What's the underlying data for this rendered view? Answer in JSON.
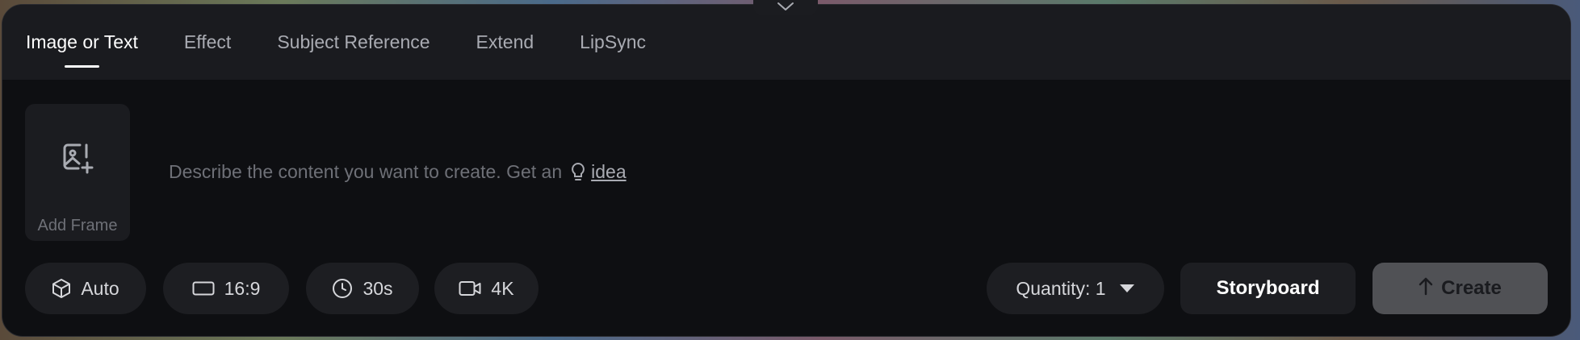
{
  "tabs": [
    {
      "label": "Image or Text",
      "active": true
    },
    {
      "label": "Effect"
    },
    {
      "label": "Subject Reference"
    },
    {
      "label": "Extend"
    },
    {
      "label": "LipSync"
    }
  ],
  "add_frame": {
    "label": "Add Frame",
    "icon": "add-image-icon"
  },
  "prompt": {
    "placeholder": "Describe the content you want to create. Get an",
    "idea_label": "idea",
    "icon": "lightbulb-icon"
  },
  "options": {
    "model": {
      "label": "Auto",
      "icon": "cube-icon"
    },
    "aspect": {
      "label": "16:9",
      "icon": "aspect-ratio-icon"
    },
    "duration": {
      "label": "30s",
      "icon": "clock-icon"
    },
    "resolution": {
      "label": "4K",
      "icon": "video-camera-icon"
    }
  },
  "quantity": {
    "label": "Quantity: 1",
    "icon": "caret-down-icon"
  },
  "storyboard_label": "Storyboard",
  "create": {
    "label": "Create",
    "icon": "arrow-up-icon"
  },
  "colors": {
    "panel_bg": "#0e0f12",
    "tab_bar_bg": "#1a1b1f",
    "chip_bg": "#1d1e22",
    "create_bg": "#505155",
    "active_text": "#ffffff",
    "muted_text": "#6e7077"
  }
}
